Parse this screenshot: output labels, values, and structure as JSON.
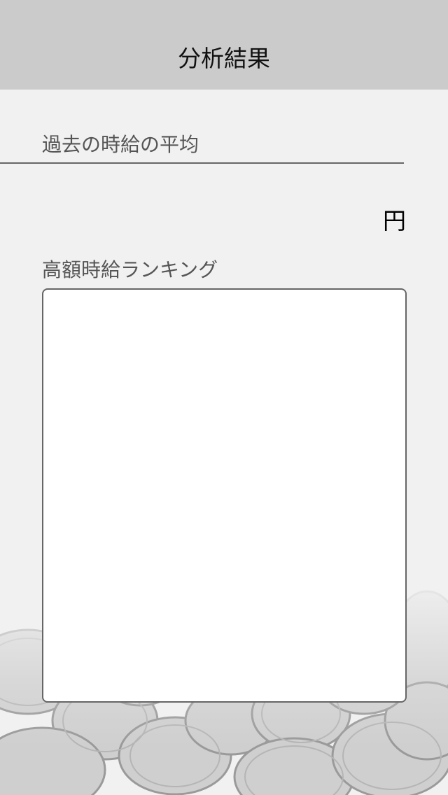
{
  "header": {
    "title": "分析結果"
  },
  "average": {
    "label": "過去の時給の平均",
    "value": "",
    "unit": "円"
  },
  "ranking": {
    "label": "高額時給ランキング",
    "items": []
  },
  "background": {
    "image": "coins-icon"
  }
}
